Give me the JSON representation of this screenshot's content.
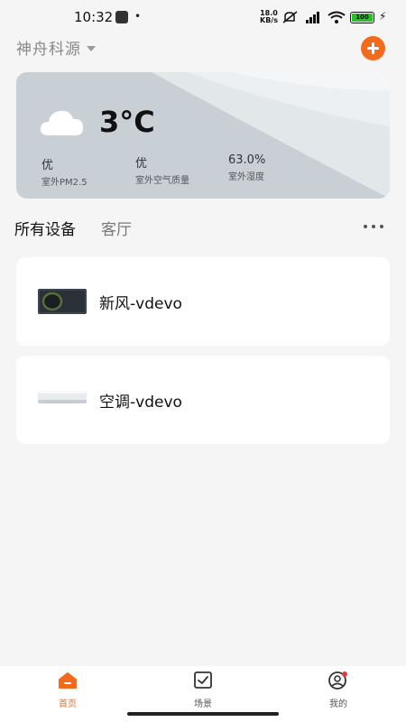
{
  "status_bar": {
    "time": "10:32",
    "net_speed_value": "18.0",
    "net_speed_unit": "KB/s",
    "battery": "100"
  },
  "header": {
    "home_name": "神舟科源"
  },
  "weather": {
    "temperature": "3°C",
    "stats": [
      {
        "value": "优",
        "label": "室外PM2.5"
      },
      {
        "value": "优",
        "label": "室外空气质量"
      },
      {
        "value": "63.0%",
        "label": "室外湿度"
      }
    ]
  },
  "tabs": [
    {
      "label": "所有设备",
      "active": true
    },
    {
      "label": "客厅",
      "active": false
    }
  ],
  "devices": [
    {
      "name": "新风-vdevo",
      "icon": "fresh-air-unit-icon"
    },
    {
      "name": "空调-vdevo",
      "icon": "air-conditioner-icon"
    }
  ],
  "bottom_nav": [
    {
      "label": "首页",
      "icon": "home-icon",
      "active": true
    },
    {
      "label": "场景",
      "icon": "scene-checkbox-icon",
      "active": false
    },
    {
      "label": "我的",
      "icon": "profile-icon",
      "active": false,
      "badge": true
    }
  ],
  "colors": {
    "accent": "#f26b1d",
    "background": "#f5f5f5",
    "card": "#ffffff",
    "notification_dot": "#e53935"
  }
}
